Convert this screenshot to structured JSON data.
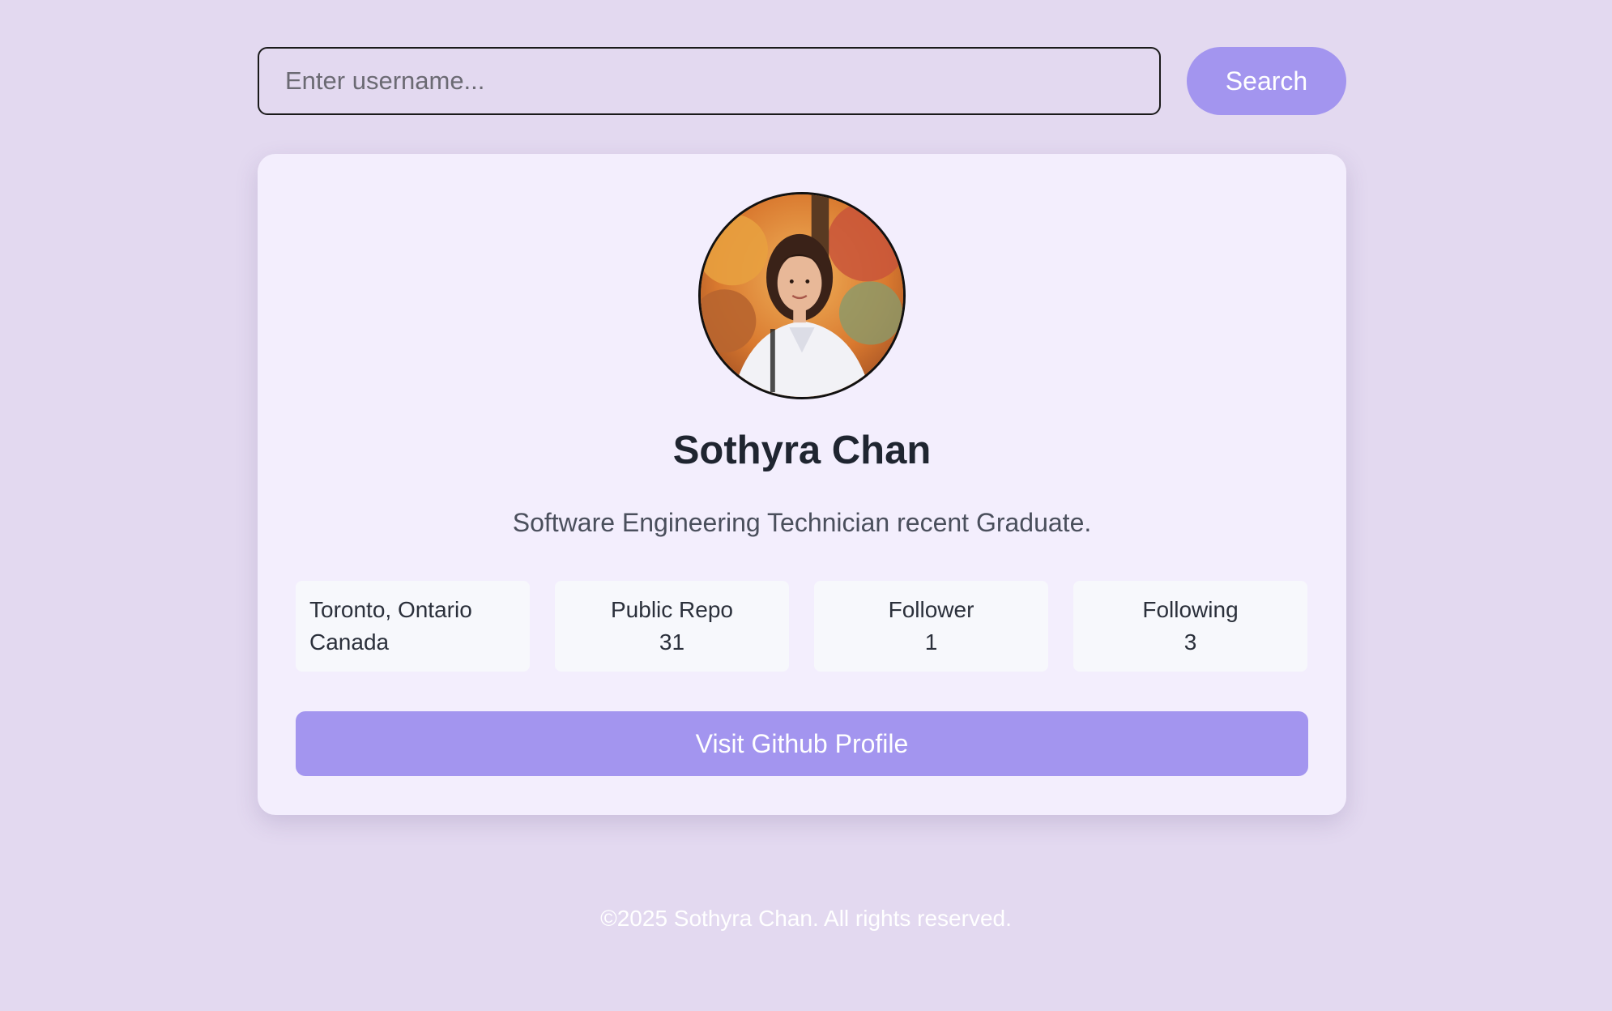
{
  "search": {
    "placeholder": "Enter username...",
    "value": "",
    "button_label": "Search"
  },
  "profile": {
    "name": "Sothyra Chan",
    "bio": "Software Engineering Technician recent Graduate.",
    "avatar_icon": "profile-photo",
    "location": {
      "city": "Toronto, Ontario",
      "country": "Canada"
    },
    "stats": {
      "repos_label": "Public Repo",
      "repos_value": "31",
      "followers_label": "Follower",
      "followers_value": "1",
      "following_label": "Following",
      "following_value": "3"
    },
    "visit_button_label": "Visit Github Profile"
  },
  "footer": {
    "text": "©2025 Sothyra Chan. All rights reserved."
  },
  "colors": {
    "background": "#e3d9f0",
    "card": "#f3eefd",
    "accent": "#a395ef",
    "stat_box": "#f7f8fc",
    "text_dark": "#1f2530"
  }
}
